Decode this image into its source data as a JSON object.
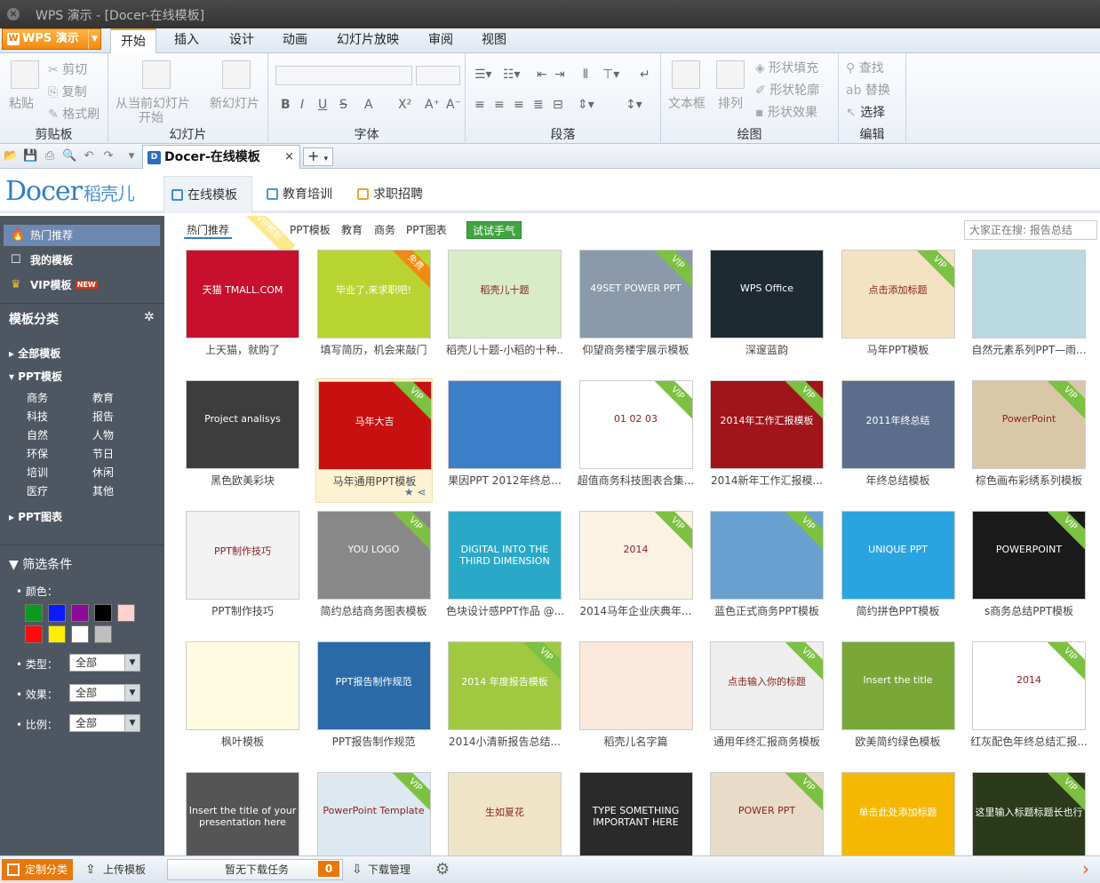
{
  "window": {
    "title": "WPS 演示 - [Docer-在线模板]"
  },
  "menu": {
    "app_button": "WPS 演示",
    "tabs": [
      "开始",
      "插入",
      "设计",
      "动画",
      "幻灯片放映",
      "审阅",
      "视图"
    ]
  },
  "ribbon": {
    "clipboard": {
      "paste": "粘贴",
      "cut": "剪切",
      "copy": "复制",
      "format_painter": "格式刷",
      "label": "剪贴板"
    },
    "slides": {
      "from_current_1": "从当前幻灯片",
      "from_current_2": "开始",
      "new_slide": "新幻灯片",
      "label": "幻灯片"
    },
    "font": {
      "label": "字体",
      "bold": "B",
      "italic": "I",
      "underline": "U",
      "strike": "S",
      "font_color": "A",
      "superscript": "X²",
      "grow": "A⁺",
      "shrink": "A⁻"
    },
    "paragraph": {
      "label": "段落"
    },
    "drawing": {
      "textbox": "文本框",
      "arrange": "排列",
      "shape_fill": "形状填充",
      "shape_outline": "形状轮廓",
      "shape_effect": "形状效果",
      "label": "绘图"
    },
    "editing": {
      "find": "查找",
      "replace": "替换",
      "select": "选择",
      "label": "编辑"
    }
  },
  "doc_tab": {
    "title": "Docer-在线模板",
    "close": "×",
    "new": "+"
  },
  "docer": {
    "logo_en": "Docer",
    "logo_cn": "稻壳儿",
    "tabs": [
      "在线模板",
      "教育培训",
      "求职招聘"
    ]
  },
  "sidebar": {
    "top_items": [
      {
        "label": "热门推荐",
        "icon": "flame-icon"
      },
      {
        "label": "我的模板",
        "icon": "square-icon"
      },
      {
        "label": "VIP模板",
        "icon": "crown-icon",
        "badge": "NEW"
      }
    ],
    "categories_title": "模板分类",
    "tree": {
      "all": "全部模板",
      "ppt": "PPT模板",
      "ppt_chart": "PPT图表"
    },
    "subcats": [
      [
        "商务",
        "教育"
      ],
      [
        "科技",
        "报告"
      ],
      [
        "自然",
        "人物"
      ],
      [
        "环保",
        "节日"
      ],
      [
        "培训",
        "休闲"
      ],
      [
        "医疗",
        "其他"
      ]
    ],
    "filter_title": "筛选条件",
    "color_label": "颜色：",
    "colors": [
      "#0a9a1c",
      "#0a1aff",
      "#8a0a9a",
      "#000000",
      "#ffd0d0",
      "#ff0a0a",
      "#ffee00",
      "#ffffff",
      "#bfbfbf"
    ],
    "filters": [
      {
        "label": "类型：",
        "value": "全部"
      },
      {
        "label": "效果：",
        "value": "全部"
      },
      {
        "label": "比例：",
        "value": "全部"
      }
    ]
  },
  "content": {
    "filter_tabs": [
      "热门推荐",
      "VIP模板",
      "PPT模板",
      "教育",
      "商务",
      "PPT图表"
    ],
    "try_button": "试试手气",
    "search_placeholder": "大家正在搜: 报告总结",
    "vip_badge": "VIP",
    "free_badge": "免费",
    "templates": [
      {
        "title": "上天猫，就购了",
        "color": "#c8102e",
        "thumb_text": "天猫 TMALL.COM",
        "vip": false
      },
      {
        "title": "填写简历，机会来敲门",
        "color": "#b8d430",
        "thumb_text": "毕业了,来求职吧!",
        "vip": false,
        "free": true
      },
      {
        "title": "稻壳儿十题-小稻的十种...",
        "color": "#d9ecc8",
        "thumb_text": "稻壳儿十题",
        "vip": false
      },
      {
        "title": "仰望商务楼宇展示模板",
        "color": "#8a9aaa",
        "thumb_text": "49SET POWER PPT",
        "vip": true
      },
      {
        "title": "深邃蓝韵",
        "color": "#1e2a32",
        "thumb_text": "WPS Office",
        "vip": false
      },
      {
        "title": "马年PPT模板",
        "color": "#f4e2c4",
        "thumb_text": "点击添加标题",
        "vip": true
      },
      {
        "title": "自然元素系列PPT—雨...",
        "color": "#b9d8e0",
        "thumb_text": "",
        "vip": false
      },
      {
        "title": "黑色欧美彩块",
        "color": "#3d3d3d",
        "thumb_text": "Project analisys",
        "vip": false
      },
      {
        "title": "马年通用PPT模板",
        "color": "#c81010",
        "thumb_text": "马年大吉",
        "vip": true,
        "selected": true
      },
      {
        "title": "果因PPT 2012年终总...",
        "color": "#3a7fc8",
        "thumb_text": "",
        "vip": false
      },
      {
        "title": "超值商务科技图表合集...",
        "color": "#ffffff",
        "thumb_text": "01 02 03",
        "vip": true
      },
      {
        "title": "2014新年工作汇报模...",
        "color": "#a0141a",
        "thumb_text": "2014年工作汇报模板",
        "vip": true
      },
      {
        "title": "年终总结模板",
        "color": "#5a6e8c",
        "thumb_text": "2011年终总结",
        "vip": false
      },
      {
        "title": "棕色画布彩绣系列模板",
        "color": "#d9c8a8",
        "thumb_text": "PowerPoint",
        "vip": true
      },
      {
        "title": "PPT制作技巧",
        "color": "#f2f2f2",
        "thumb_text": "PPT制作技巧",
        "vip": false
      },
      {
        "title": "简约总结商务图表模板",
        "color": "#888888",
        "thumb_text": "YOU LOGO",
        "vip": true
      },
      {
        "title": "色块设计感PPT作品 @...",
        "color": "#2aa8c8",
        "thumb_text": "DIGITAL INTO THE THIRD DIMENSION",
        "vip": false
      },
      {
        "title": "2014马年企业庆典年...",
        "color": "#fbf2e4",
        "thumb_text": "2014",
        "vip": true
      },
      {
        "title": "蓝色正式商务PPT模板",
        "color": "#6aa0d0",
        "thumb_text": "",
        "vip": true
      },
      {
        "title": "简约拼色PPT模板",
        "color": "#2aa4e0",
        "thumb_text": "UNIQUE PPT",
        "vip": false
      },
      {
        "title": "s商务总结PPT模板",
        "color": "#1a1a1a",
        "thumb_text": "POWERPOINT",
        "vip": true
      },
      {
        "title": "枫叶模板",
        "color": "#fffbe0",
        "thumb_text": "",
        "vip": false
      },
      {
        "title": "PPT报告制作规范",
        "color": "#2a6aa8",
        "thumb_text": "PPT报告制作规范",
        "vip": false
      },
      {
        "title": "2014小清新报告总结...",
        "color": "#a0c840",
        "thumb_text": "2014 年度报告模板",
        "vip": true
      },
      {
        "title": "稻壳儿名字篇",
        "color": "#fbe8dc",
        "thumb_text": "",
        "vip": false
      },
      {
        "title": "通用年终汇报商务模板",
        "color": "#eeeeee",
        "thumb_text": "点击输入你的标题",
        "vip": true
      },
      {
        "title": "欧美简约绿色模板",
        "color": "#7aa838",
        "thumb_text": "Insert the title",
        "vip": false
      },
      {
        "title": "红灰配色年终总结汇报...",
        "color": "#ffffff",
        "thumb_text": "2014",
        "vip": true
      },
      {
        "title": "",
        "color": "#555555",
        "thumb_text": "Insert the title of your presentation here",
        "vip": false
      },
      {
        "title": "",
        "color": "#dde8f0",
        "thumb_text": "PowerPoint Template",
        "vip": true
      },
      {
        "title": "",
        "color": "#f0e4c8",
        "thumb_text": "生如夏花",
        "vip": false
      },
      {
        "title": "",
        "color": "#2a2a2a",
        "thumb_text": "TYPE SOMETHING IMPORTANT HERE",
        "vip": false
      },
      {
        "title": "",
        "color": "#e8dcc8",
        "thumb_text": "POWER PPT",
        "vip": true
      },
      {
        "title": "",
        "color": "#f5b800",
        "thumb_text": "单击此处添加标题",
        "vip": false
      },
      {
        "title": "",
        "color": "#2a3a1a",
        "thumb_text": "这里输入标题标题长也行",
        "vip": true
      }
    ]
  },
  "status": {
    "custom_category": "定制分类",
    "upload": "上传模板",
    "download_status": "暂无下载任务",
    "download_count": "0",
    "download_manager": "下载管理"
  }
}
